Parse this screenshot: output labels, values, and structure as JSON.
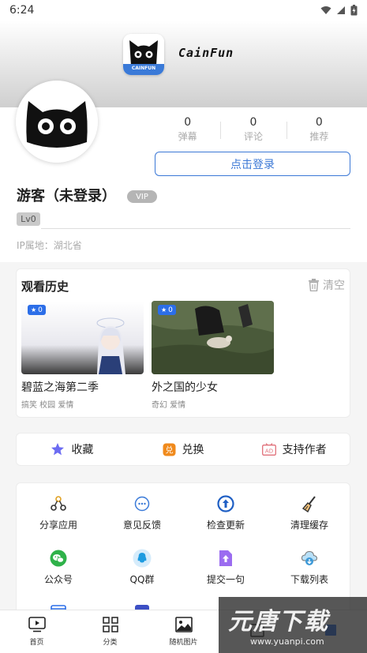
{
  "status_bar": {
    "time": "6:24"
  },
  "header": {
    "app_name": "CainFun",
    "logo_text": "CAINFUN"
  },
  "profile": {
    "stats": [
      {
        "value": "0",
        "label": "弹幕"
      },
      {
        "value": "0",
        "label": "评论"
      },
      {
        "value": "0",
        "label": "推荐"
      }
    ],
    "login_label": "点击登录",
    "username": "游客（未登录）",
    "vip": "VIP",
    "level": "Lv0",
    "ip_location": "IP属地：湖北省"
  },
  "history": {
    "title": "观看历史",
    "clear_label": "清空",
    "items": [
      {
        "badge": "0",
        "title": "碧蓝之海第二季",
        "tags": "搞笑 校园 爱情"
      },
      {
        "badge": "0",
        "title": "外之国的少女",
        "tags": "奇幻 爱情"
      }
    ]
  },
  "actions": [
    {
      "label": "收藏",
      "icon": "star-icon"
    },
    {
      "label": "兑换",
      "icon": "exchange-icon"
    },
    {
      "label": "支持作者",
      "icon": "ad-icon"
    }
  ],
  "tools": [
    {
      "label": "分享应用",
      "icon": "share-icon"
    },
    {
      "label": "意见反馈",
      "icon": "feedback-icon"
    },
    {
      "label": "检查更新",
      "icon": "update-icon"
    },
    {
      "label": "清理缓存",
      "icon": "broom-icon"
    },
    {
      "label": "公众号",
      "icon": "wechat-icon"
    },
    {
      "label": "QQ群",
      "icon": "qq-icon"
    },
    {
      "label": "提交一句",
      "icon": "submit-icon"
    },
    {
      "label": "下载列表",
      "icon": "download-icon"
    }
  ],
  "bottom_nav": [
    {
      "label": "首页",
      "icon": "tv-icon"
    },
    {
      "label": "分类",
      "icon": "grid-icon"
    },
    {
      "label": "随机图片",
      "icon": "image-icon"
    },
    {
      "label": "",
      "icon": "ranking-icon"
    },
    {
      "label": "",
      "icon": "user-icon"
    }
  ],
  "watermark": {
    "text": "元唐下载",
    "url": "www.yuanpi.com"
  },
  "colors": {
    "accent": "#3b78d6",
    "badge": "#2c6ee8",
    "background": "#f5f5f5"
  }
}
